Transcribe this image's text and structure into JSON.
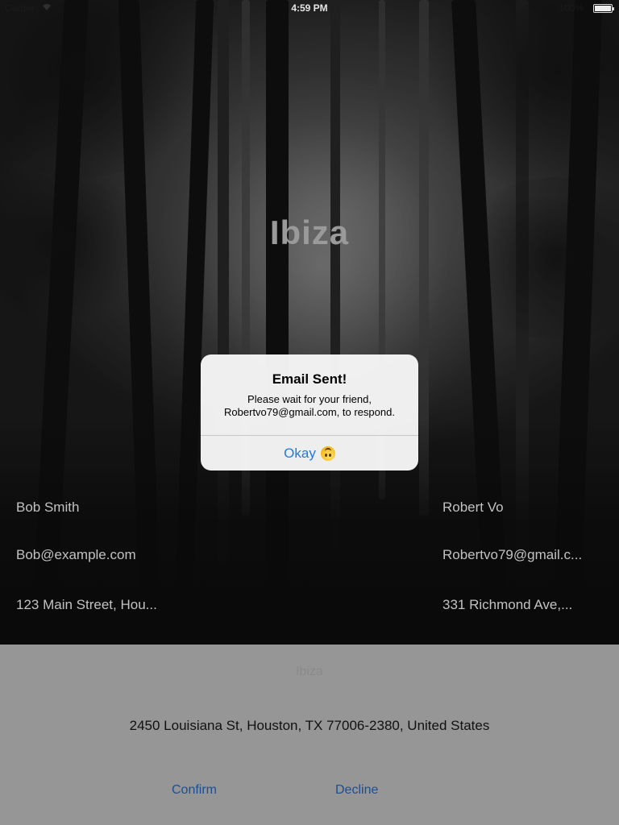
{
  "status_bar": {
    "carrier": "Carrier",
    "wifi_icon": "wifi-icon",
    "time": "4:59 PM",
    "battery_percent": "100%",
    "battery_icon": "battery-icon"
  },
  "hero": {
    "title": "Ibiza"
  },
  "contacts": {
    "left": {
      "name": "Bob Smith",
      "email": "Bob@example.com",
      "address": "123 Main Street, Hou..."
    },
    "right": {
      "name": "Robert Vo",
      "email": "Robertvo79@gmail.c...",
      "address": "331 Richmond Ave,..."
    }
  },
  "sheet": {
    "title": "Ibiza",
    "address": "2450 Louisiana St, Houston, TX  77006-2380, United States",
    "confirm_label": "Confirm",
    "decline_label": "Decline"
  },
  "alert": {
    "title": "Email Sent!",
    "message_line1": "Please wait for your friend,",
    "message_line2": "Robertvo79@gmail.com, to respond.",
    "button_label": "Okay",
    "button_emoji_icon": "upside-down-face-icon"
  },
  "colors": {
    "accent": "#1e7ae0",
    "sheet_bg": "#969696",
    "sheet_button": "#1a4f94"
  }
}
